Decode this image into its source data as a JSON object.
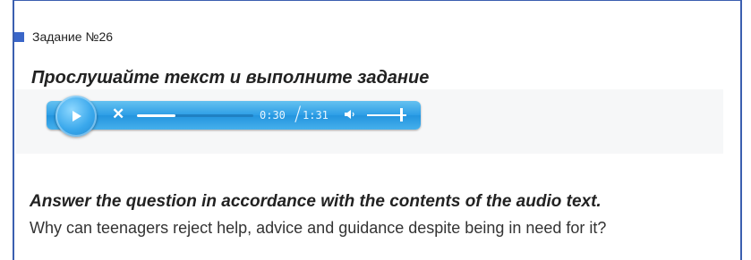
{
  "task": {
    "label": "Задание №26"
  },
  "instruction": "Прослушайте текст и выполните задание",
  "player": {
    "current_time": "0:30",
    "total_time": "1:31",
    "progress": 0.33,
    "volume": 0.9,
    "icons": {
      "play": "play-icon",
      "close": "close-icon",
      "volume": "volume-icon"
    },
    "colors": {
      "bar": "#2d9ee6",
      "button": "#3aa8ec"
    }
  },
  "question": {
    "heading": "Answer the question in accordance with the contents of the audio text.",
    "text": "Why can teenagers reject help, advice and guidance despite being in need for it?"
  }
}
